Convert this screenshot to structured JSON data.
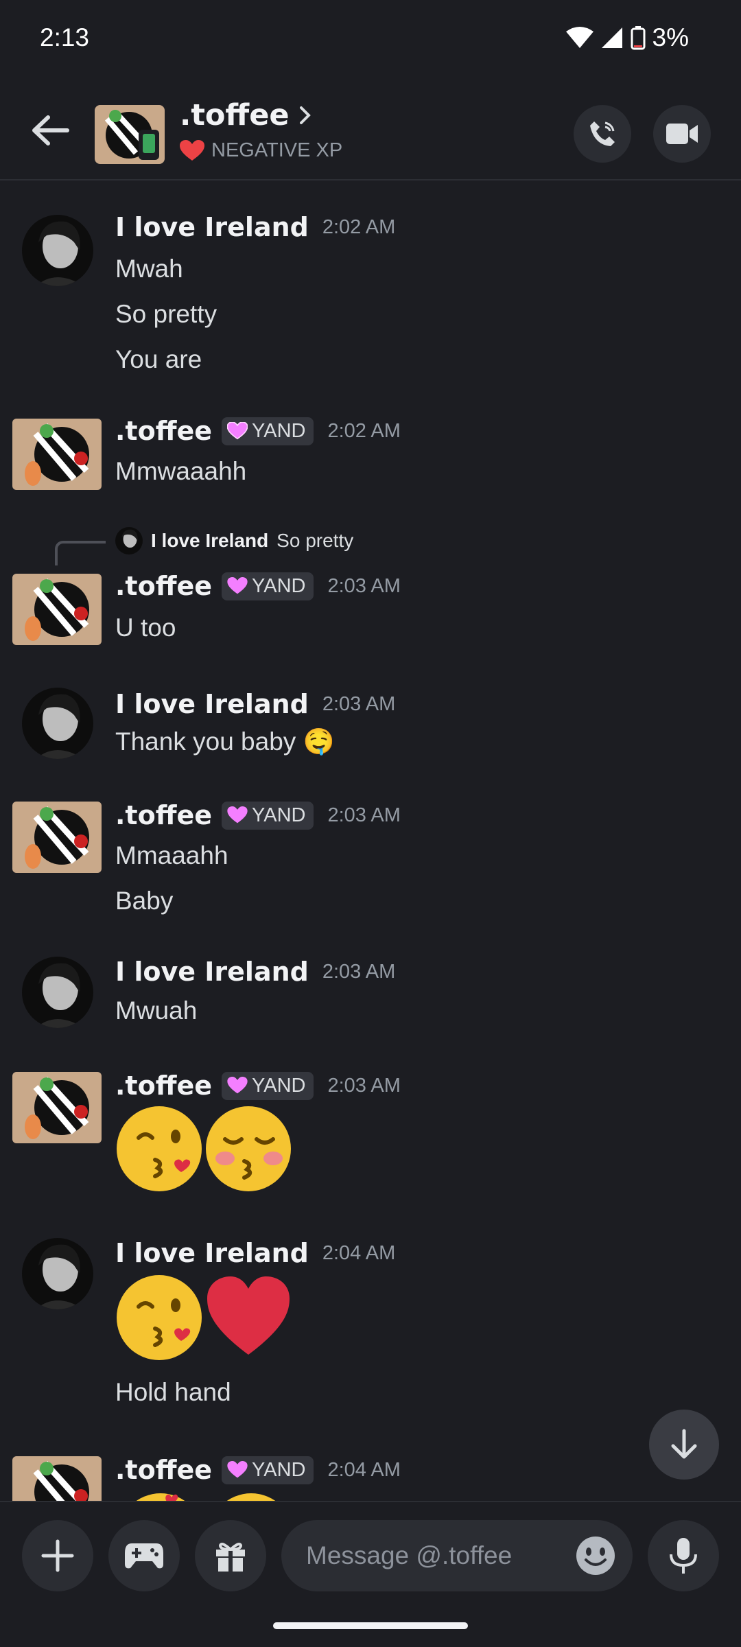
{
  "status_bar": {
    "time": "2:13",
    "battery": "3%"
  },
  "header": {
    "title": ".toffee",
    "subtitle": "NEGATIVE XP"
  },
  "messages": [
    {
      "author": "I love Ireland",
      "time": "2:02 AM",
      "lines": [
        "Mwah",
        "So pretty",
        "You are"
      ]
    },
    {
      "author": ".toffee",
      "tag": "YAND",
      "time": "2:02 AM",
      "lines": [
        "Mmwaaahh"
      ]
    },
    {
      "reply_author": "I love Ireland",
      "reply_text": "So pretty",
      "author": ".toffee",
      "tag": "YAND",
      "time": "2:03 AM",
      "lines": [
        "U too"
      ]
    },
    {
      "author": "I love Ireland",
      "time": "2:03 AM",
      "lines": [
        "Thank you baby 🤤"
      ]
    },
    {
      "author": ".toffee",
      "tag": "YAND",
      "time": "2:03 AM",
      "lines": [
        "Mmaaahh",
        "Baby"
      ]
    },
    {
      "author": "I love Ireland",
      "time": "2:03 AM",
      "lines": [
        "Mwuah"
      ]
    },
    {
      "author": ".toffee",
      "tag": "YAND",
      "time": "2:03 AM",
      "emojis": [
        "😘",
        "😚"
      ]
    },
    {
      "author": "I love Ireland",
      "time": "2:04 AM",
      "emojis": [
        "😘",
        "❤️"
      ],
      "lines": [
        "Hold hand"
      ]
    },
    {
      "author": ".toffee",
      "tag": "YAND",
      "time": "2:04 AM"
    }
  ],
  "composer": {
    "placeholder": "Message @.toffee"
  },
  "colors": {
    "background": "#1c1d22",
    "surface": "#2b2d33",
    "tag_heart": "#f47fff",
    "status_heart": "#ed4245"
  }
}
